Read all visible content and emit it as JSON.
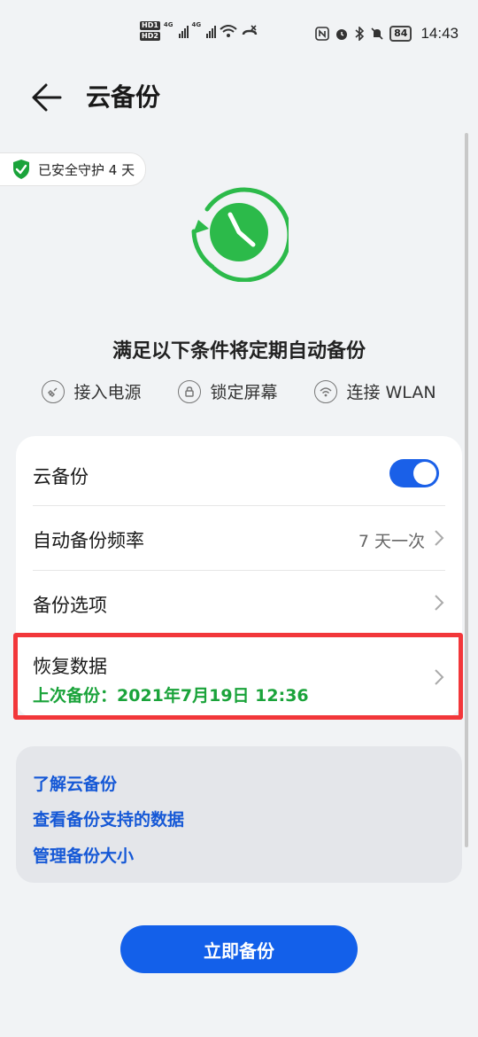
{
  "status_bar": {
    "hd1": "HD1",
    "hd2": "HD2",
    "network1": "4G",
    "network2": "4G",
    "battery": "84",
    "time": "14:43"
  },
  "header": {
    "title": "云备份"
  },
  "protection": {
    "text": "已安全守护 4 天"
  },
  "conditions": {
    "title": "满足以下条件将定期自动备份",
    "items": [
      {
        "label": "接入电源",
        "icon": "plug-icon"
      },
      {
        "label": "锁定屏幕",
        "icon": "lock-icon"
      },
      {
        "label": "连接 WLAN",
        "icon": "wifi-icon"
      }
    ]
  },
  "settings": {
    "cloud_backup_label": "云备份",
    "cloud_backup_enabled": true,
    "frequency_label": "自动备份频率",
    "frequency_value": "7 天一次",
    "options_label": "备份选项",
    "restore_label": "恢复数据",
    "last_backup": "上次备份：2021年7月19日 12:36"
  },
  "links": [
    "了解云备份",
    "查看备份支持的数据",
    "管理备份大小"
  ],
  "action": {
    "backup_now": "立即备份"
  },
  "colors": {
    "accent": "#1360ea",
    "success": "#1aa33a",
    "highlight": "#f2373a"
  }
}
